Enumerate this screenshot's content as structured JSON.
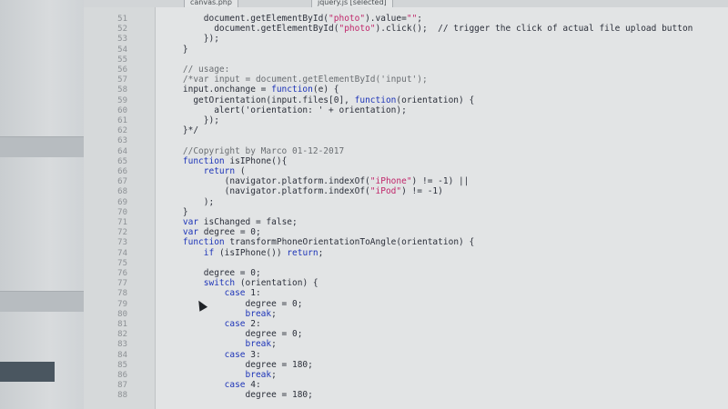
{
  "tabs": [
    {
      "label": "canvas.php"
    },
    {
      "label": "jquery.js  [selected]"
    }
  ],
  "accent_colors": {
    "keyword": "#1d34b8",
    "string": "#c0266a",
    "comment": "#6a6e72"
  },
  "code_lines": [
    {
      "num": "51",
      "fold": "",
      "text": "        document.getElementById(\"photo\").value=\"\";"
    },
    {
      "num": "52",
      "fold": "",
      "text": "          document.getElementById(\"photo\").click();  // trigger the click of actual file upload button"
    },
    {
      "num": "53",
      "fold": "",
      "text": "        });"
    },
    {
      "num": "54",
      "fold": "",
      "text": "    }"
    },
    {
      "num": "55",
      "fold": "",
      "text": ""
    },
    {
      "num": "56",
      "fold": "",
      "text": "    // usage:"
    },
    {
      "num": "57",
      "fold": "",
      "text": "    /*var input = document.getElementById('input');"
    },
    {
      "num": "58",
      "fold": "",
      "text": "    input.onchange = function(e) {"
    },
    {
      "num": "59",
      "fold": "",
      "text": "      getOrientation(input.files[0], function(orientation) {"
    },
    {
      "num": "60",
      "fold": "",
      "text": "          alert('orientation: ' + orientation);"
    },
    {
      "num": "61",
      "fold": "",
      "text": "        });"
    },
    {
      "num": "62",
      "fold": "",
      "text": "    }*/"
    },
    {
      "num": "63",
      "fold": "",
      "text": ""
    },
    {
      "num": "64",
      "fold": "",
      "text": "    //Copyright by Marco 01-12-2017"
    },
    {
      "num": "65",
      "fold": "",
      "text": "    function isIPhone(){"
    },
    {
      "num": "66",
      "fold": "",
      "text": "        return ("
    },
    {
      "num": "67",
      "fold": "",
      "text": "            (navigator.platform.indexOf(\"iPhone\") != -1) ||"
    },
    {
      "num": "68",
      "fold": "",
      "text": "            (navigator.platform.indexOf(\"iPod\") != -1)"
    },
    {
      "num": "69",
      "fold": "",
      "text": "        );"
    },
    {
      "num": "70",
      "fold": "",
      "text": "    }"
    },
    {
      "num": "71",
      "fold": "",
      "text": "    var isChanged = false;"
    },
    {
      "num": "72",
      "fold": "",
      "text": "    var degree = 0;"
    },
    {
      "num": "73",
      "fold": "",
      "text": "    function transformPhoneOrientationToAngle(orientation) {"
    },
    {
      "num": "74",
      "fold": "",
      "text": "        if (isIPhone()) return;"
    },
    {
      "num": "75",
      "fold": "",
      "text": ""
    },
    {
      "num": "76",
      "fold": "",
      "text": "        degree = 0;"
    },
    {
      "num": "77",
      "fold": "",
      "text": "        switch (orientation) {"
    },
    {
      "num": "78",
      "fold": "",
      "text": "            case 1:"
    },
    {
      "num": "79",
      "fold": "",
      "text": "                degree = 0;"
    },
    {
      "num": "80",
      "fold": "",
      "text": "                break;"
    },
    {
      "num": "81",
      "fold": "",
      "text": "            case 2:"
    },
    {
      "num": "82",
      "fold": "",
      "text": "                degree = 0;"
    },
    {
      "num": "83",
      "fold": "",
      "text": "                break;"
    },
    {
      "num": "84",
      "fold": "",
      "text": "            case 3:"
    },
    {
      "num": "85",
      "fold": "",
      "text": "                degree = 180;"
    },
    {
      "num": "86",
      "fold": "",
      "text": "                break;"
    },
    {
      "num": "87",
      "fold": "",
      "text": "            case 4:"
    },
    {
      "num": "88",
      "fold": "",
      "text": "                degree = 180;"
    }
  ]
}
